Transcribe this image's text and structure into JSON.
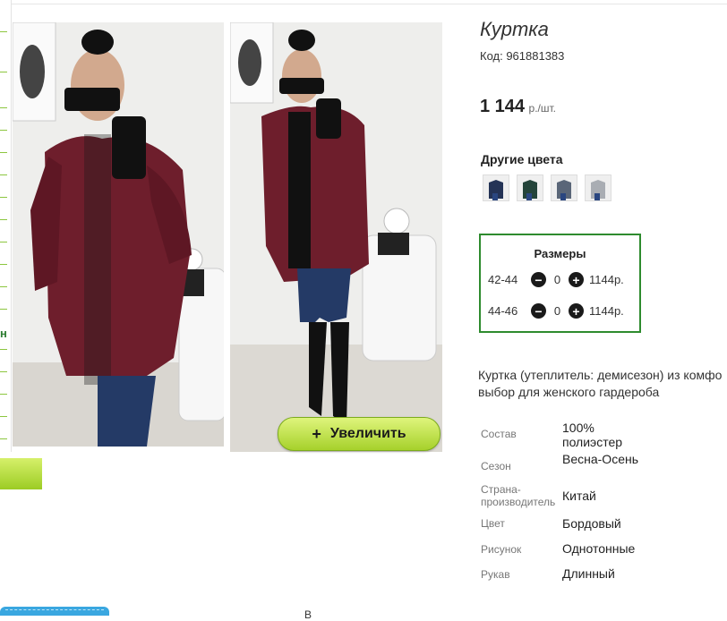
{
  "product": {
    "title": "Куртка",
    "code": "Код: 961881383",
    "price_value": "1 144",
    "price_unit": "р./шт."
  },
  "zoom": {
    "icon": "+",
    "label": "Увеличить"
  },
  "colors": {
    "title": "Другие цвета",
    "swatches": [
      "navy",
      "dark-green",
      "grey-blue",
      "light-grey"
    ]
  },
  "sizes": {
    "title": "Размеры",
    "rows": [
      {
        "size": "42-44",
        "qty": "0",
        "price": "1144р."
      },
      {
        "size": "44-46",
        "qty": "0",
        "price": "1144р."
      }
    ],
    "minus": "−",
    "plus": "+"
  },
  "description": {
    "line1": "Куртка (утеплитель: демисезон) из комфо",
    "line2": "выбор для женского гардероба"
  },
  "properties": [
    {
      "key": "Состав",
      "value": "100% полиэстер"
    },
    {
      "key": "Сезон",
      "value": "Весна-Осень"
    },
    {
      "key": "Страна-производитель",
      "value": "Китай"
    },
    {
      "key": "Цвет",
      "value": "Бордовый"
    },
    {
      "key": "Рисунок",
      "value": "Однотонные"
    },
    {
      "key": "Рукав",
      "value": "Длинный"
    }
  ],
  "sidebar": {
    "partial_letter": "н"
  },
  "footer": {
    "partial_text": "В"
  },
  "palette": {
    "accent_green": "#2e8b2e",
    "button_green": "#a6d12b",
    "jacket_burgundy": "#6e1e2c",
    "tab_blue": "#3aa7e0"
  }
}
